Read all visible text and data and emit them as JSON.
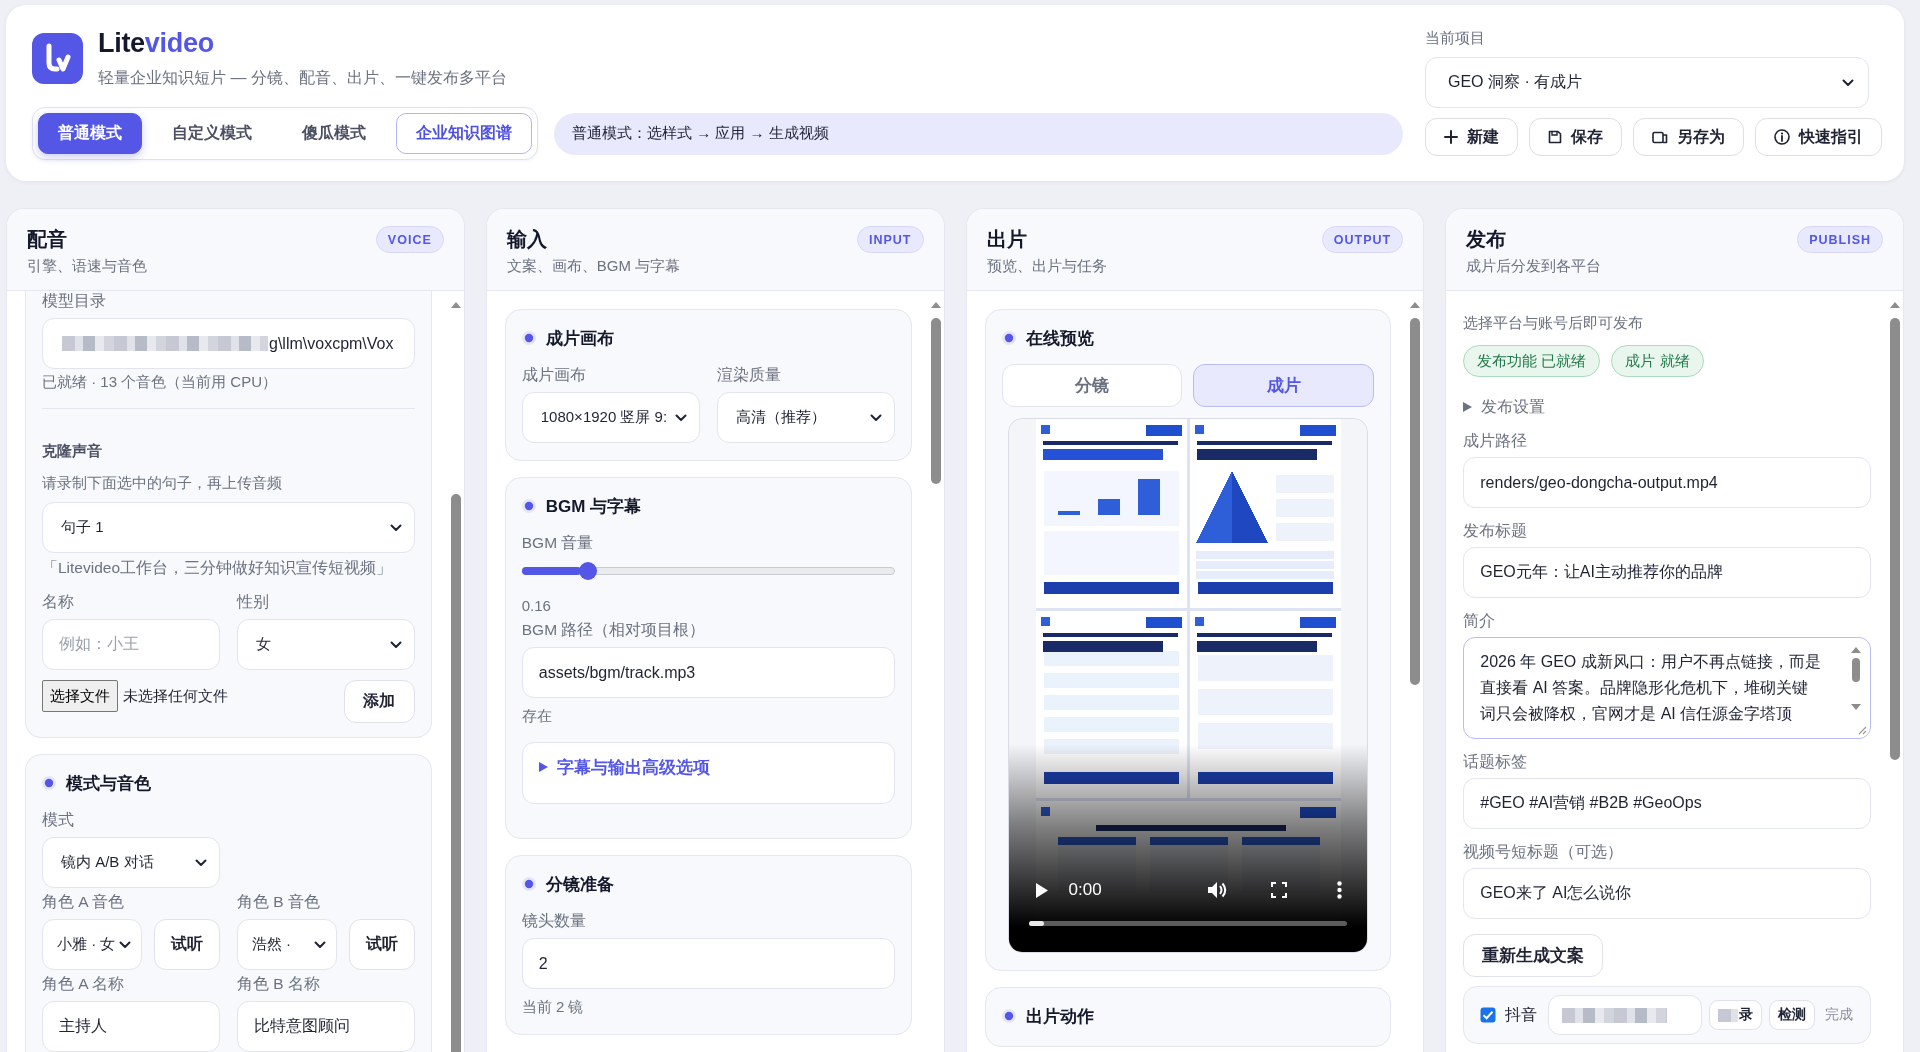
{
  "header": {
    "brand": "Lite**video**",
    "tagline": "轻量企业知识短片 — 分镜、配音、出片、一键发布多平台",
    "modes": [
      {
        "label": "普通模式",
        "selected": true,
        "outlined": false
      },
      {
        "label": "自定义模式",
        "selected": false,
        "outlined": false
      },
      {
        "label": "傻瓜模式",
        "selected": false,
        "outlined": false
      },
      {
        "label": "企业知识图谱",
        "selected": false,
        "outlined": true
      }
    ],
    "hint": "普通模式：选样式 → 应用 → 生成视频",
    "project_label": "当前项目",
    "project": "GEO 洞察 · 有成片",
    "actions": [
      {
        "kind": "create",
        "label": "新建"
      },
      {
        "kind": "save",
        "label": "保存"
      },
      {
        "kind": "save_as",
        "label": "另存为"
      },
      {
        "kind": "guide",
        "label": "快速指引"
      }
    ]
  },
  "columns": [
    {
      "kind": "voice",
      "title": "配音",
      "subtitle": "引擎、语速与音色",
      "badge": "VOICE",
      "cards": [
        {
          "items": [
            {
              "kind": "label",
              "text": "模型目录"
            },
            {
              "kind": "input",
              "redacted": true,
              "value": "g\\llm\\voxcpm\\Vox"
            },
            {
              "kind": "note",
              "text": "已就绪 · 13 个音色（当前用 CPU）"
            },
            {
              "kind": "divider"
            },
            {
              "kind": "subheading",
              "text": "克隆声音"
            },
            {
              "kind": "note",
              "text": "请录制下面选中的句子，再上传音频"
            },
            {
              "kind": "select",
              "value": "句子 1"
            },
            {
              "kind": "quote",
              "text": "「Litevideo工作台，三分钟做好知识宣传短视频」"
            },
            {
              "kind": "row",
              "cells": [
                [
                  {
                    "kind": "label",
                    "text": "名称"
                  },
                  {
                    "kind": "input",
                    "placeholder": "例如：小王"
                  }
                ],
                [
                  {
                    "kind": "label",
                    "text": "性别"
                  },
                  {
                    "kind": "select",
                    "value": "女"
                  }
                ]
              ]
            },
            {
              "kind": "file",
              "button": "选择文件",
              "status": "未选择任何文件",
              "action": "添加"
            }
          ]
        },
        {
          "title": "模式与音色",
          "items": [
            {
              "kind": "label",
              "text": "模式"
            },
            {
              "kind": "row",
              "cells": [
                [
                  {
                    "kind": "select",
                    "value": "镜内 A/B 对话"
                  }
                ]
              ]
            },
            {
              "kind": "row",
              "cells": [
                [
                  {
                    "kind": "label",
                    "text": "角色 A 音色"
                  },
                  {
                    "kind": "pick",
                    "value": "小雅 · 女",
                    "button": "试听"
                  }
                ],
                [
                  {
                    "kind": "label",
                    "text": "角色 B 音色"
                  },
                  {
                    "kind": "pick",
                    "value": "浩然 ·",
                    "button": "试听"
                  }
                ]
              ]
            },
            {
              "kind": "row",
              "cells": [
                [
                  {
                    "kind": "label",
                    "text": "角色 A 名称"
                  },
                  {
                    "kind": "input",
                    "value": "主持人"
                  }
                ],
                [
                  {
                    "kind": "label",
                    "text": "角色 B 名称"
                  },
                  {
                    "kind": "input",
                    "value": "比特意图顾问"
                  }
                ]
              ]
            }
          ]
        }
      ]
    },
    {
      "kind": "input",
      "title": "输入",
      "subtitle": "文案、画布、BGM 与字幕",
      "badge": "INPUT",
      "cards": [
        {
          "title": "成片画布",
          "items": [
            {
              "kind": "row",
              "cells": [
                [
                  {
                    "kind": "label",
                    "text": "成片画布"
                  },
                  {
                    "kind": "select",
                    "value": "1080×1920 竖屏 9:"
                  }
                ],
                [
                  {
                    "kind": "label",
                    "text": "渲染质量"
                  },
                  {
                    "kind": "select",
                    "value": "高清（推荐）"
                  }
                ]
              ]
            }
          ]
        },
        {
          "title": "BGM 与字幕",
          "items": [
            {
              "kind": "label",
              "text": "BGM 音量"
            },
            {
              "kind": "slider",
              "level": 0.16
            },
            {
              "kind": "note",
              "text": "0.16"
            },
            {
              "kind": "label",
              "text": "BGM 路径（相对项目根）"
            },
            {
              "kind": "input",
              "value": "assets/bgm/track.mp3"
            },
            {
              "kind": "note",
              "text": "存在"
            },
            {
              "kind": "details",
              "text": "字幕与输出高级选项",
              "expanded": false
            }
          ]
        },
        {
          "title": "分镜准备",
          "items": [
            {
              "kind": "label",
              "text": "镜头数量"
            },
            {
              "kind": "input",
              "value": "2"
            },
            {
              "kind": "note",
              "text": "当前 2 镜"
            }
          ]
        }
      ]
    },
    {
      "kind": "output",
      "title": "出片",
      "subtitle": "预览、出片与任务",
      "badge": "OUTPUT",
      "cards": [
        {
          "title": "在线预览",
          "items": [
            {
              "kind": "segmented",
              "options": [
                {
                  "label": "分镜",
                  "selected": false
                },
                {
                  "label": "成片",
                  "selected": true
                }
              ]
            },
            {
              "kind": "video",
              "time": "0:00",
              "level": 0.05
            }
          ]
        },
        {
          "title": "出片动作"
        }
      ]
    },
    {
      "kind": "publish",
      "title": "发布",
      "subtitle": "成片后分发到各平台",
      "badge": "PUBLISH",
      "items": [
        {
          "kind": "note",
          "text": "选择平台与账号后即可发布"
        },
        {
          "kind": "pills",
          "items": [
            {
              "text": "发布功能 已就绪",
              "kind": "success"
            },
            {
              "text": "成片 就绪",
              "kind": "success"
            }
          ]
        },
        {
          "kind": "disclosure",
          "text": "发布设置",
          "expanded": false
        },
        {
          "kind": "label",
          "text": "成片路径"
        },
        {
          "kind": "input",
          "value": "renders/geo-dongcha-output.mp4"
        },
        {
          "kind": "label",
          "text": "发布标题"
        },
        {
          "kind": "input",
          "value": "GEO元年：让AI主动推荐你的品牌"
        },
        {
          "kind": "label",
          "text": "简介"
        },
        {
          "kind": "textarea",
          "value": "2026 年 GEO 成新风口：用户不再点链接，而是直接看 AI 答案。品牌隐形化危机下，堆砌关键词只会被降权，官网才是 AI 信任源金字塔顶"
        },
        {
          "kind": "label",
          "text": "话题标签"
        },
        {
          "kind": "input",
          "value": "#GEO #AI营销 #B2B #GeoOps"
        },
        {
          "kind": "label",
          "text": "视频号短标题（可选）"
        },
        {
          "kind": "input",
          "value": "GEO来了 AI怎么说你"
        },
        {
          "kind": "button",
          "label": "重新生成文案"
        },
        {
          "kind": "platform",
          "checked": true,
          "name": "抖音",
          "account_redacted": true,
          "login": "录",
          "login_redacted": true,
          "check": "检测",
          "status": "完成"
        }
      ]
    }
  ]
}
